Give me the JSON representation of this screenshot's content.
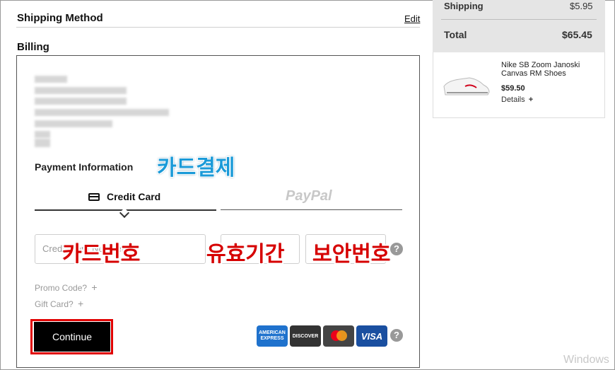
{
  "shipping_method": {
    "title": "Shipping Method",
    "edit_label": "Edit"
  },
  "billing": {
    "title": "Billing"
  },
  "payment": {
    "title": "Payment Information",
    "annotation_payment": "카드결제",
    "tab_credit": "Credit Card",
    "tab_paypal": "PayPal",
    "card_number_placeholder": "Credit Card Number",
    "annotation_card_number": "카드번호",
    "annotation_expiry": "유효기간",
    "annotation_cvv": "보안번호",
    "promo_label": "Promo Code?",
    "gift_label": "Gift Card?",
    "plus": "+",
    "help": "?",
    "continue_label": "Continue",
    "cards": [
      {
        "name": "AMERICAN EXPRESS",
        "icon": "amex-logo",
        "color": "#1f72cd"
      },
      {
        "name": "DISCOVER",
        "icon": "discover-logo",
        "color": "#333333"
      },
      {
        "name": "mastercard",
        "icon": "mastercard-logo",
        "color": "#444444"
      },
      {
        "name": "VISA",
        "icon": "visa-logo",
        "color": "#1a4fa0"
      }
    ]
  },
  "summary": {
    "shipping_label": "Shipping",
    "shipping_value": "$5.95",
    "total_label": "Total",
    "total_value": "$65.45",
    "product_name": "Nike SB Zoom Janoski Canvas RM Shoes",
    "product_price": "$59.50",
    "details_label": "Details",
    "details_plus": "+"
  },
  "watermark": "Windows",
  "colors": {
    "highlight_red": "#e00000",
    "annotation_blue": "#1a9ad8",
    "annotation_red": "#d60000"
  }
}
